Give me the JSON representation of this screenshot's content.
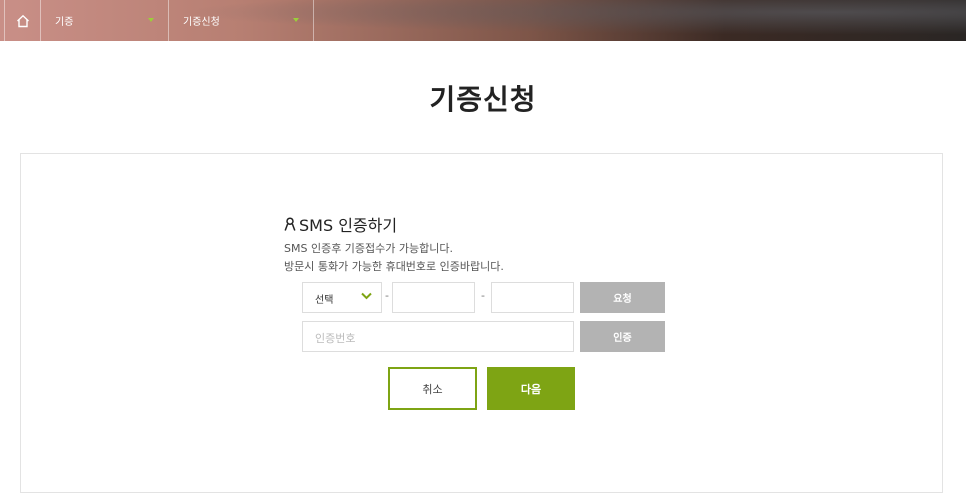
{
  "breadcrumb": {
    "home_icon": "home-icon",
    "items": [
      {
        "label": "기증"
      },
      {
        "label": "기증신청"
      }
    ],
    "caret_color": "#9bcf3a"
  },
  "page_title": "기증신청",
  "sms": {
    "heading": "SMS 인증하기",
    "heading_icon": "user-icon",
    "desc_line1": "SMS 인증후 기증접수가 가능합니다.",
    "desc_line2": "방문시 통화가 가능한 휴대번호로 인증바랍니다.",
    "phone_prefix_selected": "선택",
    "dash": "-",
    "request_button": "요청",
    "code_placeholder": "인증번호",
    "verify_button": "인증"
  },
  "actions": {
    "cancel": "취소",
    "next": "다음"
  },
  "colors": {
    "accent": "#7ea414",
    "gray_button": "#b3b3b3"
  }
}
